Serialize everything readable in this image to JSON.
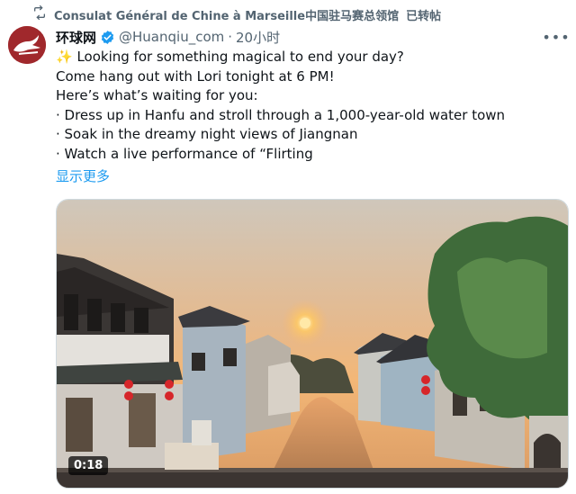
{
  "retweet": {
    "icon": "retweet-icon",
    "account": "Consulat Général de Chine à Marseille中国驻马赛总领馆",
    "action": "已转帖"
  },
  "tweet": {
    "display_name": "环球网",
    "handle": "@Huanqiu_com",
    "separator": "·",
    "time": "20小时",
    "verified_color": "#1d9bf0",
    "lines": [
      "✨ Looking for something magical to end your day?",
      "Come hang out with Lori tonight at 6 PM!",
      "Here’s what’s waiting for you:",
      "· Dress up in Hanfu and stroll through a 1,000-year-old water town",
      "· Soak in the dreamy night views of Jiangnan",
      "· Watch a live performance of “Flirting"
    ],
    "show_more": "显示更多"
  },
  "media": {
    "duration": "0:18"
  }
}
